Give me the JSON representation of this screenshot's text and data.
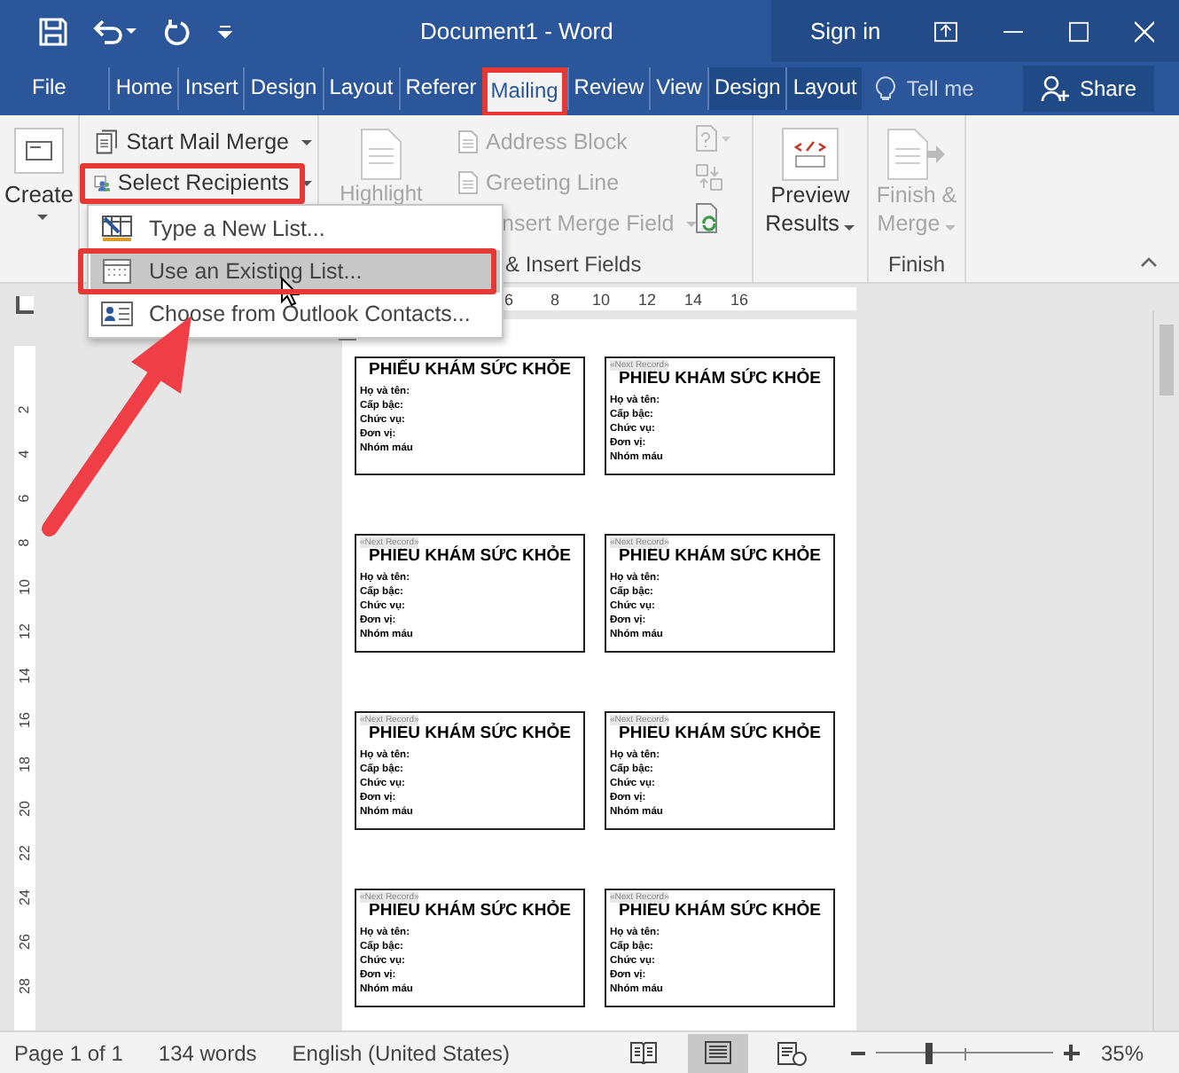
{
  "window": {
    "title": "Document1  -  Word",
    "sign_in": "Sign in"
  },
  "tabs": [
    {
      "label": "File",
      "selected": false,
      "contextual": false
    },
    {
      "label": "Home",
      "selected": false,
      "contextual": false
    },
    {
      "label": "Insert",
      "selected": false,
      "contextual": false
    },
    {
      "label": "Design",
      "selected": false,
      "contextual": false
    },
    {
      "label": "Layout",
      "selected": false,
      "contextual": false
    },
    {
      "label": "Referer",
      "selected": false,
      "contextual": false
    },
    {
      "label": "Mailing",
      "selected": true,
      "contextual": false
    },
    {
      "label": "Review",
      "selected": false,
      "contextual": false
    },
    {
      "label": "View",
      "selected": false,
      "contextual": false
    },
    {
      "label": "Design",
      "selected": false,
      "contextual": true
    },
    {
      "label": "Layout",
      "selected": false,
      "contextual": true
    }
  ],
  "tell_me": "Tell me",
  "share": "Share",
  "ribbon": {
    "create": "Create",
    "start_mail_merge": "Start Mail Merge",
    "select_recipients": "Select Recipients",
    "highlight": "Highlight",
    "fields": [
      {
        "label": "Address Block",
        "disabled": true
      },
      {
        "label": "Greeting Line",
        "disabled": true
      },
      {
        "label": "nsert Merge Field",
        "disabled": true
      }
    ],
    "write_group_label": "& Insert Fields",
    "preview": [
      "Preview",
      "Results"
    ],
    "finish": [
      "Finish &",
      "Merge"
    ],
    "finish_group_label": "Finish"
  },
  "menu": [
    {
      "label": "Type a New List...",
      "selected": false
    },
    {
      "label": "Use an Existing List...",
      "selected": true
    },
    {
      "label": "Choose from Outlook Contacts...",
      "selected": false
    }
  ],
  "ruler": {
    "horizontal": [
      "6",
      "8",
      "10",
      "12",
      "14",
      "16"
    ],
    "vertical": [
      "2",
      "4",
      "6",
      "8",
      "10",
      "12",
      "14",
      "16",
      "18",
      "20",
      "22",
      "24",
      "26",
      "28"
    ]
  },
  "labels": [
    {
      "title": "PHIẾU KHÁM SỨC KHỎE",
      "lines": [
        "Họ và tên:",
        "Cấp bậc:",
        "Chức vụ:",
        "Đơn vị:",
        "Nhóm máu"
      ]
    },
    {
      "next_record": "«Next Record»",
      "title": "PHIẾU KHÁM SỨC KHỎE",
      "lines": [
        "Họ và tên:",
        "Cấp bậc:",
        "Chức vụ:",
        "Đơn vị:",
        "Nhóm máu"
      ]
    },
    {
      "next_record": "«Next Record»",
      "title": "PHIẾU KHÁM SỨC KHỎE",
      "lines": [
        "Họ và tên:",
        "Cấp bậc:",
        "Chức vụ:",
        "Đơn vị:",
        "Nhóm máu"
      ]
    },
    {
      "next_record": "«Next Record»",
      "title": "PHIẾU KHÁM SỨC KHỎE",
      "lines": [
        "Họ và tên:",
        "Cấp bậc:",
        "Chức vụ:",
        "Đơn vị:",
        "Nhóm máu"
      ]
    },
    {
      "next_record": "«Next Record»",
      "title": "PHIẾU KHÁM SỨC KHỎE",
      "lines": [
        "Họ và tên:",
        "Cấp bậc:",
        "Chức vụ:",
        "Đơn vị:",
        "Nhóm máu"
      ]
    },
    {
      "next_record": "«Next Record»",
      "title": "PHIẾU KHÁM SỨC KHỎE",
      "lines": [
        "Họ và tên:",
        "Cấp bậc:",
        "Chức vụ:",
        "Đơn vị:",
        "Nhóm máu"
      ]
    },
    {
      "next_record": "«Next Record»",
      "title": "PHIẾU KHÁM SỨC KHỎE",
      "lines": [
        "Họ và tên:",
        "Cấp bậc:",
        "Chức vụ:",
        "Đơn vị:",
        "Nhóm máu"
      ]
    },
    {
      "next_record": "«Next Record»",
      "title": "PHIẾU KHÁM SỨC KHỎE",
      "lines": [
        "Họ và tên:",
        "Cấp bậc:",
        "Chức vụ:",
        "Đơn vị:",
        "Nhóm máu"
      ]
    }
  ],
  "status_bar": {
    "page": "Page 1 of 1",
    "words": "134 words",
    "language": "English (United States)",
    "views": [
      {
        "kind": "read",
        "selected": false
      },
      {
        "kind": "print",
        "selected": true
      },
      {
        "kind": "web",
        "selected": false
      }
    ],
    "zoom": {
      "level": 0.3,
      "reading": "35%"
    }
  }
}
